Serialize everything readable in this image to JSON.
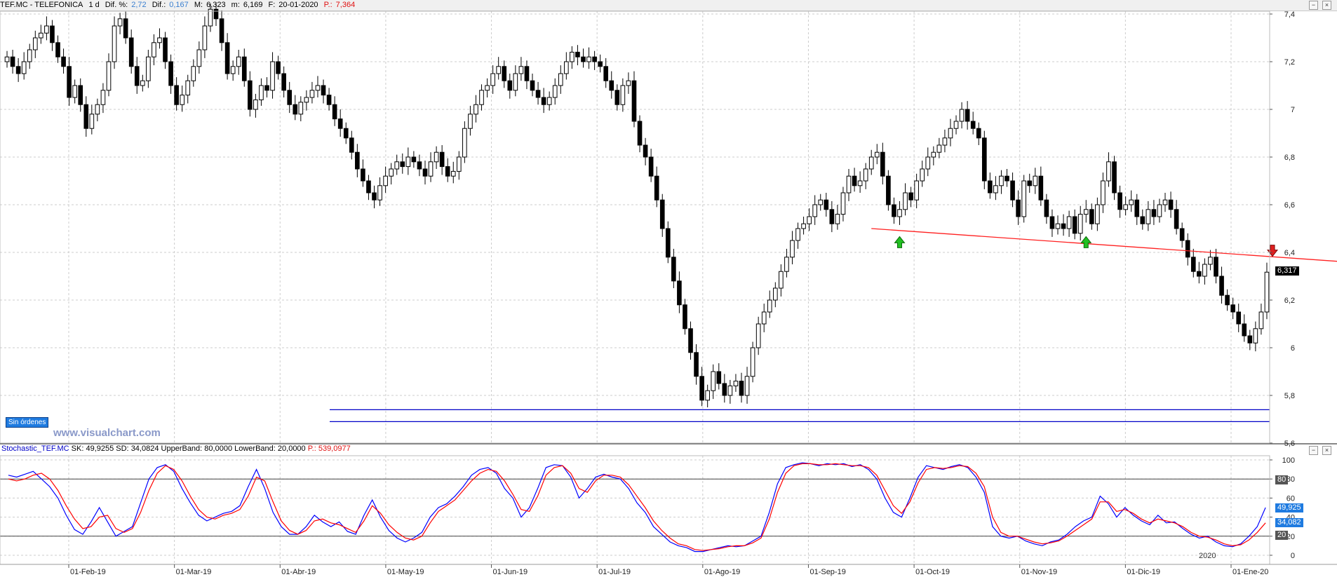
{
  "header": {
    "symbol": "TEF.MC - TELEFONICA",
    "interval": "1 d",
    "dif_pct_label": "Dif. %:",
    "dif_pct": "2,72",
    "dif_label": "Dif.:",
    "dif": "0,167",
    "max_label": "M:",
    "max": "6,323",
    "min_label": "m:",
    "min": "6,169",
    "date_label": "F:",
    "date": "20-01-2020",
    "p_label": "P.:",
    "p": "7,364"
  },
  "orders_label": "Sin órdenes",
  "watermark": "www.visualchart.com",
  "indicator": {
    "name": "Stochastic_TEF.MC",
    "sk_label": "SK:",
    "sk": "49,9255",
    "sd_label": "SD:",
    "sd": "34,0824",
    "upper_label": "UpperBand:",
    "upper": "80,0000",
    "lower_label": "LowerBand:",
    "lower": "20,0000",
    "p_label": "P.:",
    "p": "539,0977"
  },
  "price_tag": "6,317",
  "sk_tag": "49,925",
  "sd_tag": "34,082",
  "upper_tag": "80",
  "lower_tag": "20",
  "year_label": "2020",
  "colors": {
    "sk_line": "#0000ff",
    "sd_line": "#ff0000",
    "trendline": "#ff2020",
    "support": "#0000c8",
    "buy_arrow": "#22c022",
    "sell_arrow": "#e02020",
    "tag_blue": "#1f7be0"
  },
  "chart_data": [
    {
      "type": "candlestick",
      "x_labels": [
        "01-Feb-19",
        "01-Mar-19",
        "01-Abr-19",
        "01-May-19",
        "01-Jun-19",
        "01-Jul-19",
        "01-Ago-19",
        "01-Sep-19",
        "01-Oct-19",
        "01-Nov-19",
        "01-Dic-19",
        "01-Ene-20"
      ],
      "y_ticks": [
        "7,4",
        "7,2",
        "7",
        "6,8",
        "6,6",
        "6,4",
        "6,2",
        "6",
        "5,8",
        "5,6"
      ],
      "ylim": [
        5.6,
        7.4
      ],
      "close": [
        7.22,
        7.18,
        7.15,
        7.2,
        7.25,
        7.3,
        7.32,
        7.35,
        7.28,
        7.22,
        7.18,
        7.05,
        7.1,
        7.02,
        6.92,
        6.98,
        7.02,
        7.08,
        7.2,
        7.35,
        7.38,
        7.3,
        7.18,
        7.1,
        7.12,
        7.22,
        7.28,
        7.3,
        7.2,
        7.1,
        7.02,
        7.06,
        7.12,
        7.18,
        7.25,
        7.35,
        7.42,
        7.38,
        7.28,
        7.15,
        7.18,
        7.22,
        7.12,
        7.0,
        7.04,
        7.1,
        7.08,
        7.2,
        7.15,
        7.08,
        7.02,
        6.98,
        7.03,
        7.05,
        7.08,
        7.1,
        7.06,
        7.02,
        6.96,
        6.92,
        6.88,
        6.82,
        6.75,
        6.7,
        6.65,
        6.62,
        6.68,
        6.72,
        6.75,
        6.78,
        6.76,
        6.8,
        6.78,
        6.75,
        6.72,
        6.78,
        6.82,
        6.76,
        6.72,
        6.74,
        6.8,
        6.92,
        6.98,
        7.02,
        7.08,
        7.1,
        7.15,
        7.18,
        7.12,
        7.08,
        7.15,
        7.18,
        7.12,
        7.08,
        7.05,
        7.02,
        7.05,
        7.1,
        7.15,
        7.2,
        7.24,
        7.22,
        7.2,
        7.22,
        7.2,
        7.18,
        7.12,
        7.08,
        7.02,
        7.1,
        7.12,
        6.95,
        6.85,
        6.8,
        6.72,
        6.62,
        6.5,
        6.38,
        6.28,
        6.18,
        6.08,
        5.98,
        5.88,
        5.78,
        5.82,
        5.9,
        5.85,
        5.8,
        5.84,
        5.86,
        5.8,
        5.88,
        6.0,
        6.1,
        6.15,
        6.2,
        6.25,
        6.32,
        6.38,
        6.45,
        6.5,
        6.52,
        6.55,
        6.6,
        6.62,
        6.58,
        6.52,
        6.56,
        6.65,
        6.72,
        6.68,
        6.7,
        6.75,
        6.8,
        6.82,
        6.72,
        6.6,
        6.55,
        6.58,
        6.65,
        6.62,
        6.7,
        6.75,
        6.8,
        6.82,
        6.85,
        6.88,
        6.92,
        6.95,
        7.0,
        6.95,
        6.92,
        6.88,
        6.7,
        6.65,
        6.68,
        6.72,
        6.7,
        6.62,
        6.55,
        6.7,
        6.68,
        6.72,
        6.62,
        6.55,
        6.5,
        6.52,
        6.5,
        6.55,
        6.48,
        6.56,
        6.58,
        6.52,
        6.6,
        6.7,
        6.78,
        6.65,
        6.58,
        6.6,
        6.62,
        6.55,
        6.52,
        6.58,
        6.55,
        6.6,
        6.62,
        6.58,
        6.5,
        6.45,
        6.38,
        6.32,
        6.3,
        6.35,
        6.38,
        6.3,
        6.22,
        6.18,
        6.15,
        6.1,
        6.05,
        6.02,
        6.08,
        6.15,
        6.317
      ],
      "trendline": [
        [
          153,
          6.5
        ],
        [
          237,
          6.36
        ]
      ],
      "support_levels": [
        5.74,
        5.69
      ],
      "buy_signals": [
        158,
        191
      ],
      "sell_signals": [
        224
      ],
      "last_price": 6.317
    },
    {
      "type": "line",
      "title": "Stochastic_TEF.MC",
      "y_ticks": [
        "100",
        "80",
        "60",
        "40",
        "20",
        "0"
      ],
      "ylim": [
        0,
        100
      ],
      "bands": [
        80,
        20
      ],
      "series": [
        {
          "name": "SK",
          "color": "#0000ff",
          "values": [
            84,
            82,
            85,
            88,
            80,
            72,
            60,
            42,
            27,
            22,
            35,
            50,
            35,
            20,
            25,
            30,
            55,
            80,
            92,
            95,
            88,
            70,
            55,
            42,
            36,
            40,
            44,
            46,
            52,
            72,
            90,
            70,
            45,
            30,
            22,
            22,
            30,
            42,
            35,
            30,
            35,
            25,
            22,
            42,
            58,
            40,
            26,
            18,
            14,
            18,
            24,
            40,
            50,
            54,
            62,
            72,
            84,
            90,
            92,
            86,
            70,
            60,
            40,
            50,
            70,
            92,
            95,
            94,
            82,
            60,
            70,
            82,
            85,
            82,
            80,
            70,
            55,
            45,
            30,
            22,
            14,
            10,
            8,
            4,
            4,
            6,
            8,
            10,
            9,
            10,
            15,
            20,
            45,
            75,
            92,
            95,
            97,
            96,
            94,
            96,
            95,
            96,
            93,
            95,
            90,
            80,
            60,
            45,
            40,
            60,
            82,
            94,
            92,
            90,
            93,
            95,
            92,
            82,
            66,
            30,
            20,
            18,
            20,
            15,
            12,
            10,
            14,
            16,
            22,
            30,
            36,
            40,
            62,
            54,
            40,
            50,
            42,
            36,
            32,
            42,
            34,
            35,
            28,
            22,
            18,
            20,
            14,
            10,
            9,
            12,
            20,
            30,
            50
          ]
        },
        {
          "name": "SD",
          "color": "#ff0000",
          "values": [
            80,
            78,
            80,
            84,
            86,
            80,
            68,
            52,
            38,
            28,
            30,
            40,
            42,
            28,
            24,
            28,
            45,
            68,
            86,
            94,
            90,
            78,
            62,
            48,
            40,
            38,
            42,
            44,
            48,
            62,
            82,
            78,
            56,
            36,
            26,
            22,
            26,
            36,
            38,
            34,
            32,
            28,
            24,
            36,
            52,
            44,
            32,
            24,
            18,
            16,
            20,
            34,
            46,
            52,
            58,
            68,
            78,
            86,
            90,
            88,
            78,
            64,
            48,
            46,
            62,
            84,
            92,
            94,
            86,
            70,
            66,
            78,
            84,
            84,
            82,
            74,
            62,
            50,
            36,
            26,
            18,
            12,
            10,
            6,
            5,
            6,
            7,
            9,
            10,
            10,
            13,
            18,
            38,
            66,
            86,
            94,
            96,
            96,
            95,
            95,
            96,
            95,
            94,
            94,
            92,
            84,
            68,
            52,
            44,
            56,
            76,
            90,
            92,
            91,
            92,
            94,
            93,
            86,
            72,
            40,
            24,
            20,
            20,
            17,
            14,
            12,
            13,
            15,
            20,
            26,
            32,
            38,
            56,
            56,
            46,
            48,
            44,
            38,
            34,
            38,
            36,
            34,
            30,
            24,
            20,
            19,
            16,
            12,
            10,
            11,
            16,
            24,
            34
          ]
        }
      ],
      "sk_last": 49.9255,
      "sd_last": 34.0824
    }
  ]
}
